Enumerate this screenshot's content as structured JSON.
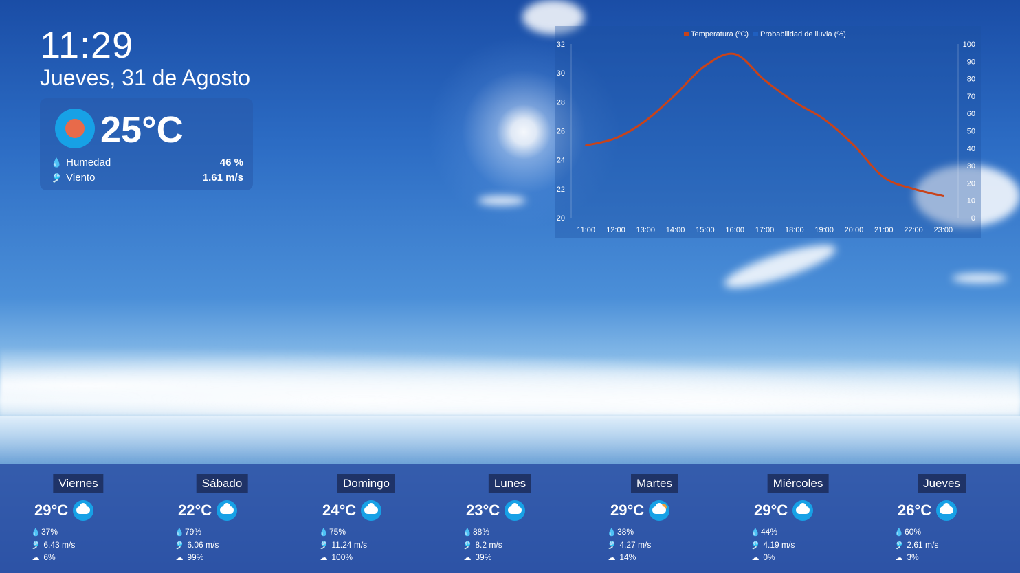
{
  "header": {
    "time": "11:29",
    "date": "Jueves, 31 de Agosto"
  },
  "current": {
    "icon": "sun-icon",
    "temperature": "25°C",
    "humidity_label": "Humedad",
    "humidity_value": "46 %",
    "wind_label": "Viento",
    "wind_value": "1.61 m/s"
  },
  "chart_data": {
    "type": "line",
    "legend": [
      "Temperatura (ºC)",
      "Probabilidad de lluvia (%)"
    ],
    "legend_position": "top",
    "x": [
      "11:00",
      "12:00",
      "13:00",
      "14:00",
      "15:00",
      "16:00",
      "17:00",
      "18:00",
      "19:00",
      "20:00",
      "21:00",
      "22:00",
      "23:00"
    ],
    "series": [
      {
        "name": "Temperatura (ºC)",
        "axis": "left",
        "color": "#c8431a",
        "values": [
          25.0,
          25.5,
          26.7,
          28.5,
          30.5,
          31.3,
          29.5,
          28.0,
          26.8,
          25.0,
          22.8,
          22.0,
          21.5
        ]
      },
      {
        "name": "Probabilidad de lluvia (%)",
        "axis": "right",
        "color": "#1f5fc0",
        "values": [
          0,
          0,
          0,
          0,
          0,
          0,
          0,
          0,
          0,
          0,
          0,
          0,
          0
        ]
      }
    ],
    "y_left": {
      "min": 20,
      "max": 32,
      "ticks": [
        "20",
        "22",
        "24",
        "26",
        "28",
        "30",
        "32"
      ]
    },
    "y_right": {
      "min": 0,
      "max": 100,
      "ticks": [
        "0",
        "10",
        "20",
        "30",
        "40",
        "50",
        "60",
        "70",
        "80",
        "90",
        "100"
      ]
    },
    "grid": false
  },
  "forecast": [
    {
      "day": "Viernes",
      "temp": "29°C",
      "icon": "cloud-icon",
      "humidity": "37%",
      "wind": "6.43 m/s",
      "rain": "6%"
    },
    {
      "day": "Sábado",
      "temp": "22°C",
      "icon": "rain-cloud-icon",
      "humidity": "79%",
      "wind": "6.06 m/s",
      "rain": "99%"
    },
    {
      "day": "Domingo",
      "temp": "24°C",
      "icon": "rain-cloud-icon",
      "humidity": "75%",
      "wind": "11.24 m/s",
      "rain": "100%"
    },
    {
      "day": "Lunes",
      "temp": "23°C",
      "icon": "rain-cloud-icon",
      "humidity": "88%",
      "wind": "8.2 m/s",
      "rain": "39%"
    },
    {
      "day": "Martes",
      "temp": "29°C",
      "icon": "partly-cloudy-icon",
      "humidity": "38%",
      "wind": "4.27 m/s",
      "rain": "14%"
    },
    {
      "day": "Miércoles",
      "temp": "29°C",
      "icon": "cloud-icon",
      "humidity": "44%",
      "wind": "4.19 m/s",
      "rain": "0%"
    },
    {
      "day": "Jueves",
      "temp": "26°C",
      "icon": "cloud-icon",
      "humidity": "60%",
      "wind": "2.61 m/s",
      "rain": "3%"
    }
  ]
}
